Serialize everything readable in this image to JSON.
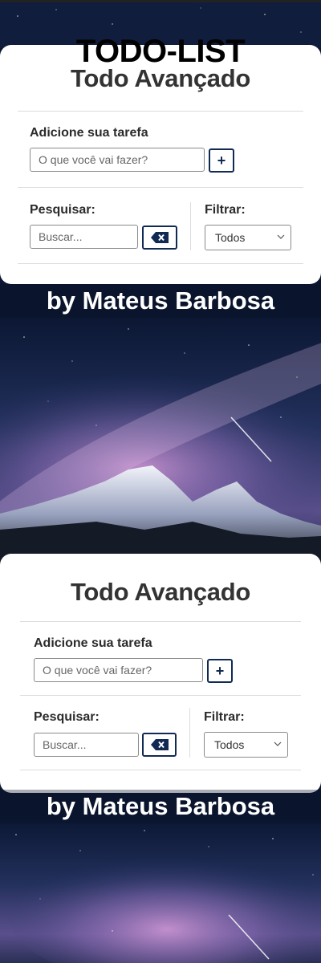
{
  "overlay_title": "TODO-LIST",
  "cards": [
    {
      "title": "Todo Avançado",
      "add_label": "Adicione sua tarefa",
      "add_placeholder": "O que você vai fazer?",
      "add_button": "+",
      "search_label": "Pesquisar:",
      "search_placeholder": "Buscar...",
      "filter_label": "Filtrar:",
      "filter_selected": "Todos"
    },
    {
      "title": "Todo Avançado",
      "add_label": "Adicione sua tarefa",
      "add_placeholder": "O que você vai fazer?",
      "add_button": "+",
      "search_label": "Pesquisar:",
      "search_placeholder": "Buscar...",
      "filter_label": "Filtrar:",
      "filter_selected": "Todos"
    }
  ],
  "captions": [
    "by Mateus Barbosa",
    "by Mateus Barbosa"
  ],
  "colors": {
    "button_border": "#102a54",
    "card_bg": "#ffffff",
    "sky_dark": "#0c1630",
    "sky_purple": "#b98ac8"
  },
  "icons": {
    "add": "plus-icon",
    "clear_search": "backspace-icon",
    "select_arrow": "chevron-down-icon"
  }
}
